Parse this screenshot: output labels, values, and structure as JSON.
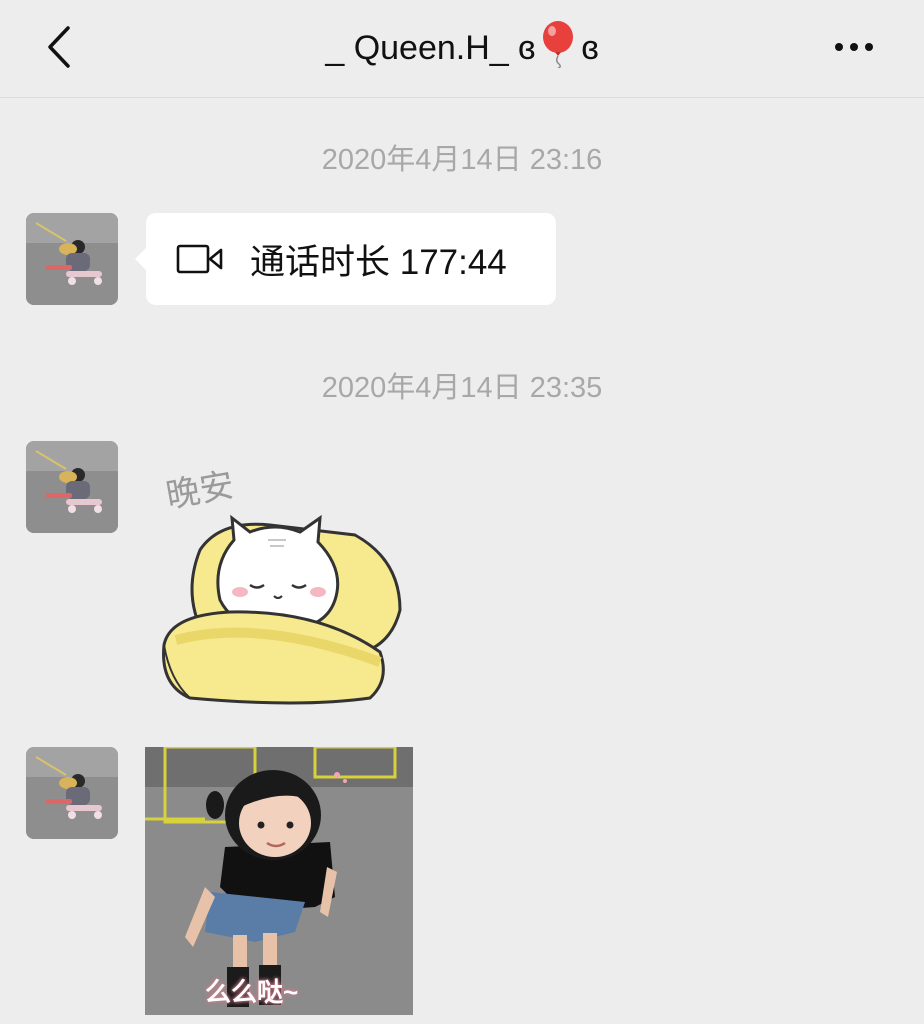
{
  "header": {
    "title": "_ Queen.H_ ɞ",
    "title_end": "ɞ",
    "back_icon": "chevron-left-icon",
    "more_icon": "ellipsis-icon"
  },
  "messages": [
    {
      "type": "timestamp",
      "text": "2020年4月14日 23:16"
    },
    {
      "type": "video_call",
      "icon": "video-camera-icon",
      "text": "通话时长 177:44"
    },
    {
      "type": "timestamp",
      "text": "2020年4月14日 23:35"
    },
    {
      "type": "sticker",
      "text": "晚安"
    },
    {
      "type": "image",
      "caption": "么么哒~"
    }
  ],
  "colors": {
    "background": "#ededed",
    "bubble": "#ffffff",
    "timestamp": "#a8a8a8",
    "sticker_yellow": "#f7e98e"
  }
}
